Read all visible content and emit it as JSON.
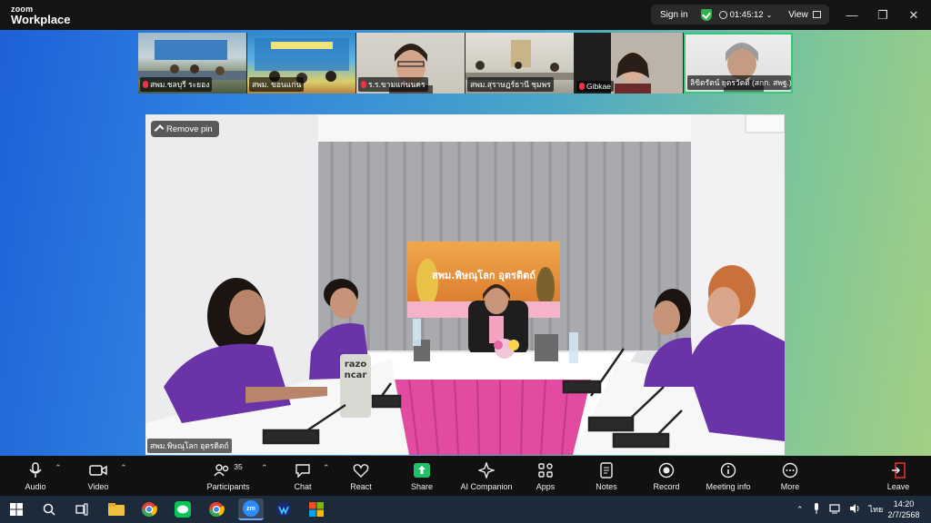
{
  "app": {
    "brand_small": "zoom",
    "brand_large": "Workplace"
  },
  "header": {
    "sign_in": "Sign in",
    "timer": "01:45:12",
    "view": "View"
  },
  "thumbnails": [
    {
      "name": "สพม.ชลบุรี ระยอง",
      "muted": true
    },
    {
      "name": "สพม. ขอนแก่น",
      "muted": false
    },
    {
      "name": "ร.ร.ขามแก่นนคร",
      "muted": true
    },
    {
      "name": "สพม.สุราษฎร์ธานี ชุมพร",
      "muted": false
    },
    {
      "name": "Gibkae",
      "muted": true
    },
    {
      "name": "ลิขิตรัตน์ ยุตรวัตติ์ (สกก. สพฐ.)",
      "muted": false
    }
  ],
  "main": {
    "remove_pin": "Remove pin",
    "speaker_name": "สพม.พิษณุโลก อุตรดิตถ์",
    "banner_text": "สพม.พิษณุโลก อุตรดิตถ์",
    "bottle_text_1": "razo",
    "bottle_text_2": "ncar"
  },
  "toolbar": {
    "audio": "Audio",
    "video": "Video",
    "participants": "Participants",
    "participants_count": "35",
    "chat": "Chat",
    "react": "React",
    "share": "Share",
    "ai_companion": "AI Companion",
    "apps": "Apps",
    "notes": "Notes",
    "record": "Record",
    "meeting_info": "Meeting info",
    "more": "More",
    "leave": "Leave"
  },
  "taskbar": {
    "lang": "ไทย",
    "time": "14:20",
    "date": "2/7/2568",
    "zoom_badge": "zm"
  },
  "colors": {
    "share_green": "#22c06b",
    "leave_red": "#e0322f",
    "active_border": "#36c77a"
  }
}
